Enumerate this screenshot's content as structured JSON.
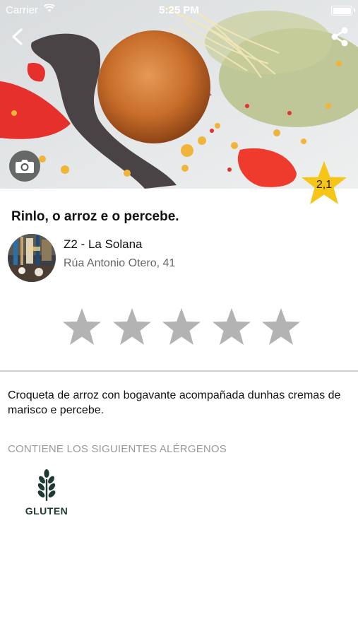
{
  "status_bar": {
    "carrier": "Carrier",
    "time": "5:25 PM",
    "battery_level": 1.0
  },
  "header": {
    "back_icon": "chevron-left-icon",
    "share_icon": "share-icon",
    "camera_icon": "camera-icon",
    "rating_badge": "2,1",
    "badge_color": "#f5c518"
  },
  "dish": {
    "title": "Rinlo, o arroz e o percebe.",
    "description": "Croqueta de arroz con bogavante acompañada dunhas cremas de marisco e percebe."
  },
  "restaurant": {
    "name": "Z2 - La Solana",
    "address": "Rúa Antonio Otero, 41"
  },
  "user_rating": {
    "max_stars": 5,
    "selected": 0,
    "star_color": "#b3b3b3"
  },
  "allergens": {
    "heading": "CONTIENE LOS SIGUIENTES ALÉRGENOS",
    "items": [
      {
        "label": "GLUTEN",
        "icon": "wheat-icon"
      }
    ]
  }
}
